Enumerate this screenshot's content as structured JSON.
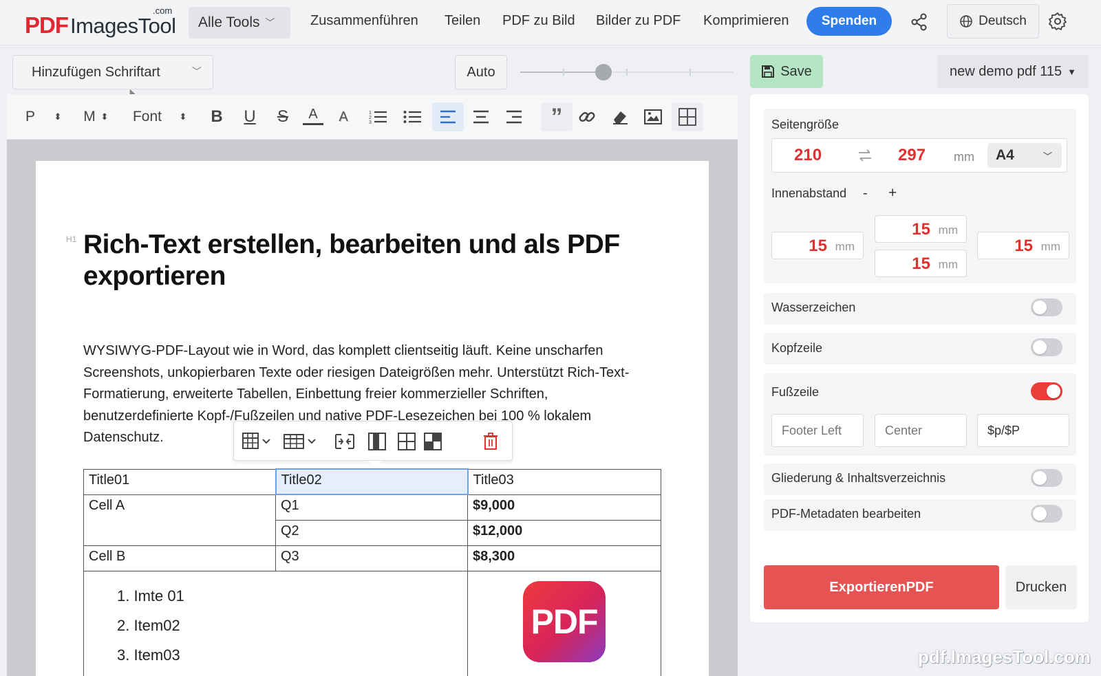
{
  "nav": {
    "logo_pdf": "PDF",
    "logo_rest": "ImagesTool",
    "logo_com": ".com",
    "all_tools": "Alle Tools",
    "links": [
      "Zusammenführen",
      "Teilen",
      "PDF zu Bild",
      "Bilder zu PDF",
      "Komprimieren"
    ],
    "donate": "Spenden",
    "language": "Deutsch"
  },
  "editor": {
    "font_picker": "Hinzufügen Schriftart",
    "auto_label": "Auto",
    "zoom_fraction": 0.38,
    "toolbar": {
      "paragraph": "P",
      "size": "M",
      "font": "Font"
    },
    "h1_tag": "H1",
    "heading": "Rich-Text erstellen, bearbeiten und als PDF exportieren",
    "paragraph": "WYSIWYG-PDF-Layout wie in Word, das komplett clientseitig läuft. Keine unscharfen Screenshots, unkopierbaren Texte oder riesigen Dateigrößen mehr. Unterstützt Rich-Text-Formatierung, erweiterte Tabellen, Einbettung freier kommerzieller Schriften, benutzerdefinierte Kopf-/Fußzeilen und native PDF-Lesezeichen bei 100 % lokalem Datenschutz.",
    "table": {
      "headers": [
        "Title01",
        "Title02",
        "Title03"
      ],
      "cell_a": "Cell A",
      "cell_b": "Cell B",
      "rows": [
        {
          "q": "Q1",
          "v": "$9,000"
        },
        {
          "q": "Q2",
          "v": "$12,000"
        },
        {
          "q": "Q3",
          "v": "$8,300"
        }
      ],
      "list": [
        "1. Imte 01",
        "2. Item02",
        "3. Item03"
      ],
      "pdf_icon_text": "PDF"
    }
  },
  "panel": {
    "save": "Save",
    "doc_name": "new demo pdf 115",
    "page_size_label": "Seitengröße",
    "width": "210",
    "height": "297",
    "unit": "mm",
    "paper": "A4",
    "padding_label": "Innenabstand",
    "padding_minus": "-",
    "padding_plus": "+",
    "padding": {
      "top": "15",
      "left": "15",
      "right": "15",
      "bottom": "15"
    },
    "watermark_label": "Wasserzeichen",
    "header_label": "Kopfzeile",
    "footer_label": "Fußzeile",
    "footer_left_placeholder": "Footer Left",
    "footer_center_placeholder": "Center",
    "footer_right_value": "$p/$P",
    "outline_label": "Gliederung & Inhaltsverzeichnis",
    "metadata_label": "PDF-Metadaten bearbeiten",
    "toggles": {
      "watermark": false,
      "header": false,
      "footer": true,
      "outline": false,
      "metadata": false
    },
    "export": "ExportierenPDF",
    "print": "Drucken"
  },
  "site_watermark": "pdf.ImagesTool.com",
  "colors": {
    "accent_blue": "#2f7dea",
    "accent_red": "#e0312f",
    "save_green": "#b4e5c5",
    "export_red": "#e55353"
  }
}
